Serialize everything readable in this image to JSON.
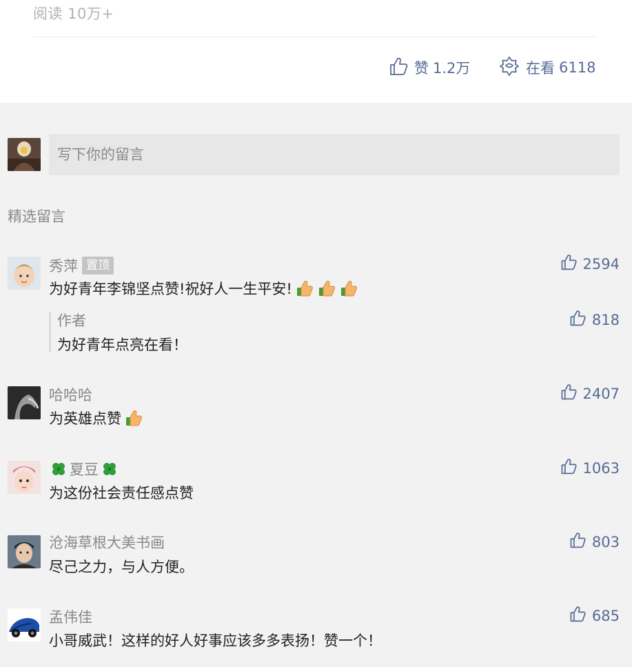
{
  "article": {
    "read_label": "阅读 10万+",
    "like_label": "赞",
    "like_count": "1.2万",
    "looking_label": "在看",
    "looking_count": "6118"
  },
  "comment_box": {
    "placeholder": "写下你的留言"
  },
  "section_title": "精选留言",
  "comments": [
    {
      "name": "秀萍",
      "badge": "置顶",
      "text": "为好青年李锦坚点赞!祝好人一生平安!",
      "likes": "2594",
      "emoji_count": 3,
      "reply": {
        "name": "作者",
        "text": "为好青年点亮在看！",
        "likes": "818"
      }
    },
    {
      "name": "哈哈哈",
      "text": "为英雄点赞",
      "likes": "2407",
      "emoji_count": 1
    },
    {
      "name": "夏豆",
      "text": "为这份社会责任感点赞",
      "likes": "1063",
      "name_decor": "four-leaf-clover-icon"
    },
    {
      "name": "沧海草根大美书画",
      "text": "尽己之力，与人方便。",
      "likes": "803"
    },
    {
      "name": "孟伟佳",
      "text": "小哥威武！这样的好人好事应该多多表扬！赞一个！",
      "likes": "685"
    }
  ],
  "colors": {
    "link_blue": "#576b95",
    "page_bg": "#f2f2f2",
    "muted_text": "#888888",
    "body_text": "#222222"
  }
}
